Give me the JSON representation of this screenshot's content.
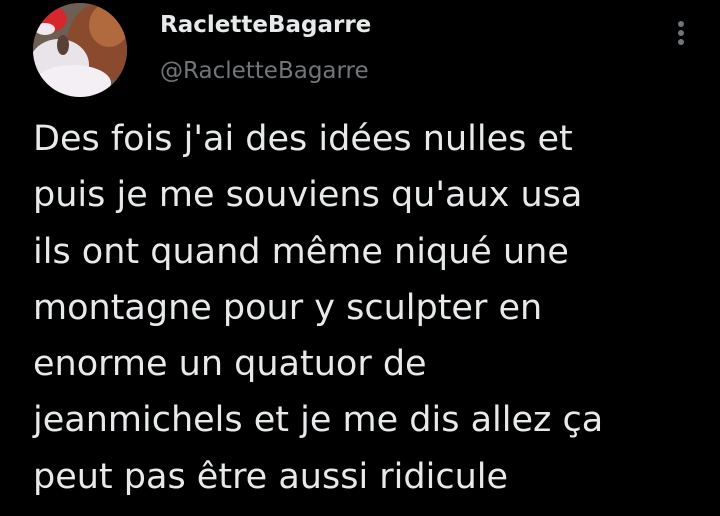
{
  "tweet": {
    "author": {
      "display_name": "RacletteBagarre",
      "handle": "@RacletteBagarre",
      "avatar_icon": "profile-photo"
    },
    "more_icon": "vertical-ellipsis-icon",
    "text_lines": [
      "Des fois j'ai des idées nulles et",
      "puis je me souviens qu'aux usa",
      "ils ont quand même niqué une",
      "montagne pour y sculpter en",
      "enorme un quatuor de",
      "jeanmichels et je me dis allez ça",
      "peut pas être aussi ridicule"
    ]
  },
  "colors": {
    "background": "#000000",
    "primary_text": "#e7e9ea",
    "secondary_text": "#71767b"
  }
}
